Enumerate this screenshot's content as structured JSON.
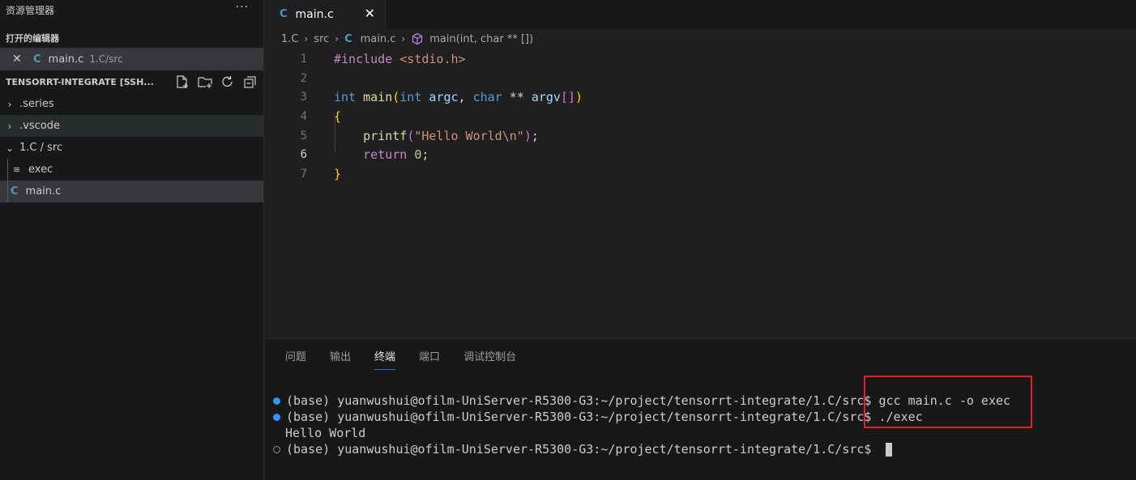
{
  "sidebar": {
    "title": "资源管理器",
    "more": "···",
    "open_editors_header": "打开的编辑器",
    "open_editor": {
      "close": "✕",
      "icon": "C",
      "name": "main.c",
      "path": "1.C/src"
    },
    "workspace_header": "TENSORRT-INTEGRATE [SSH...",
    "workspace_actions": [
      "new-file-icon",
      "new-folder-icon",
      "refresh-icon",
      "collapse-all-icon"
    ],
    "tree": [
      {
        "chevron": "›",
        "label": ".series"
      },
      {
        "chevron": "›",
        "label": ".vscode"
      },
      {
        "chevron": "⌄",
        "label": "1.C / src"
      },
      {
        "icon": "≡",
        "label": "exec"
      },
      {
        "icon": "C",
        "label": "main.c"
      }
    ]
  },
  "editor": {
    "tab": {
      "icon": "C",
      "name": "main.c",
      "close": "✕"
    },
    "breadcrumb": {
      "folder": "1.C",
      "sub": "src",
      "file": "main.c",
      "symbol": "main(int, char ** [])"
    },
    "line_numbers": [
      "1",
      "2",
      "3",
      "4",
      "5",
      "6",
      "7"
    ],
    "current_line": "6",
    "code": {
      "l1_pre": "#include ",
      "l1_hdr": "<stdio.h>",
      "l3_int": "int",
      "l3_main": "main",
      "l3_op": "(",
      "l3_int2": "int",
      "l3_argc": "argc",
      "l3_comma": ", ",
      "l3_char": "char",
      "l3_ptr": " ** ",
      "l3_argv": "argv",
      "l3_sq": "[]",
      "l3_cp": ")",
      "l4": "{",
      "l5_fn": "printf",
      "l5_op": "(",
      "l5_str": "\"Hello World\\n\"",
      "l5_cp": ")",
      "l5_semi": ";",
      "l6_kw": "return",
      "l6_num": "0",
      "l6_semi": ";",
      "l7": "}"
    }
  },
  "panel": {
    "tabs": [
      "问题",
      "输出",
      "终端",
      "端口",
      "调试控制台"
    ],
    "active_tab": "终端",
    "terminal": {
      "prompt": "(base) yuanwushui@ofilm-UniServer-R5300-G3:~/project/tensorrt-integrate/1.C/src$ ",
      "cmd1": "gcc main.c -o exec",
      "cmd2": "./exec",
      "output": "Hello World"
    }
  },
  "colors": {
    "accent": "#0078d4",
    "highlight_box": "#e02020",
    "c_icon": "#519aba"
  }
}
